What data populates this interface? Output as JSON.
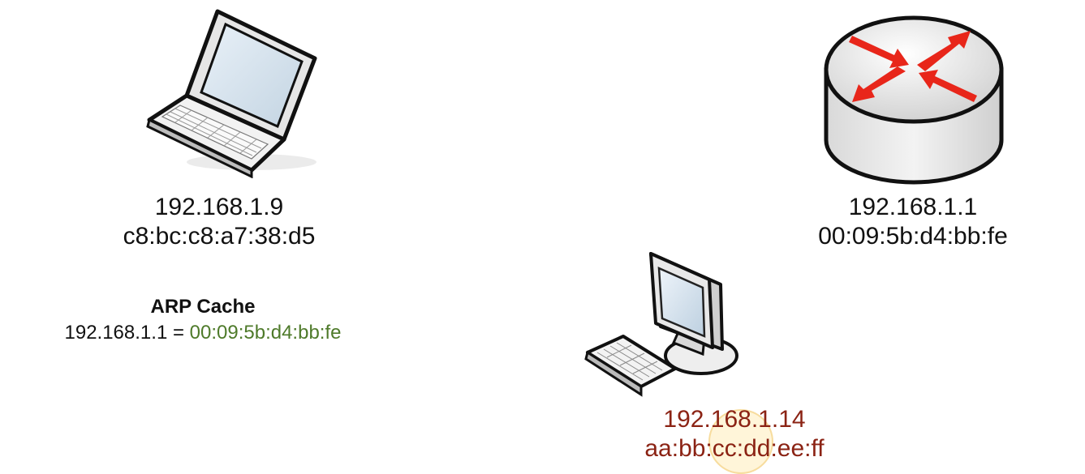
{
  "colors": {
    "highlight_green": "#4e7a2a",
    "attacker_red": "#8b2314",
    "router_arrow": "#e8261a"
  },
  "laptop": {
    "icon": "laptop-icon",
    "ip": "192.168.1.9",
    "mac": "c8:bc:c8:a7:38:d5",
    "arp_cache": {
      "title": "ARP Cache",
      "entry_ip": "192.168.1.1 = ",
      "entry_mac": "00:09:5b:d4:bb:fe"
    }
  },
  "router": {
    "icon": "router-icon",
    "ip": "192.168.1.1",
    "mac": "00:09:5b:d4:bb:fe"
  },
  "desktop": {
    "icon": "desktop-computer-icon",
    "ip": "192.168.1.14",
    "mac": "aa:bb:cc:dd:ee:ff"
  }
}
